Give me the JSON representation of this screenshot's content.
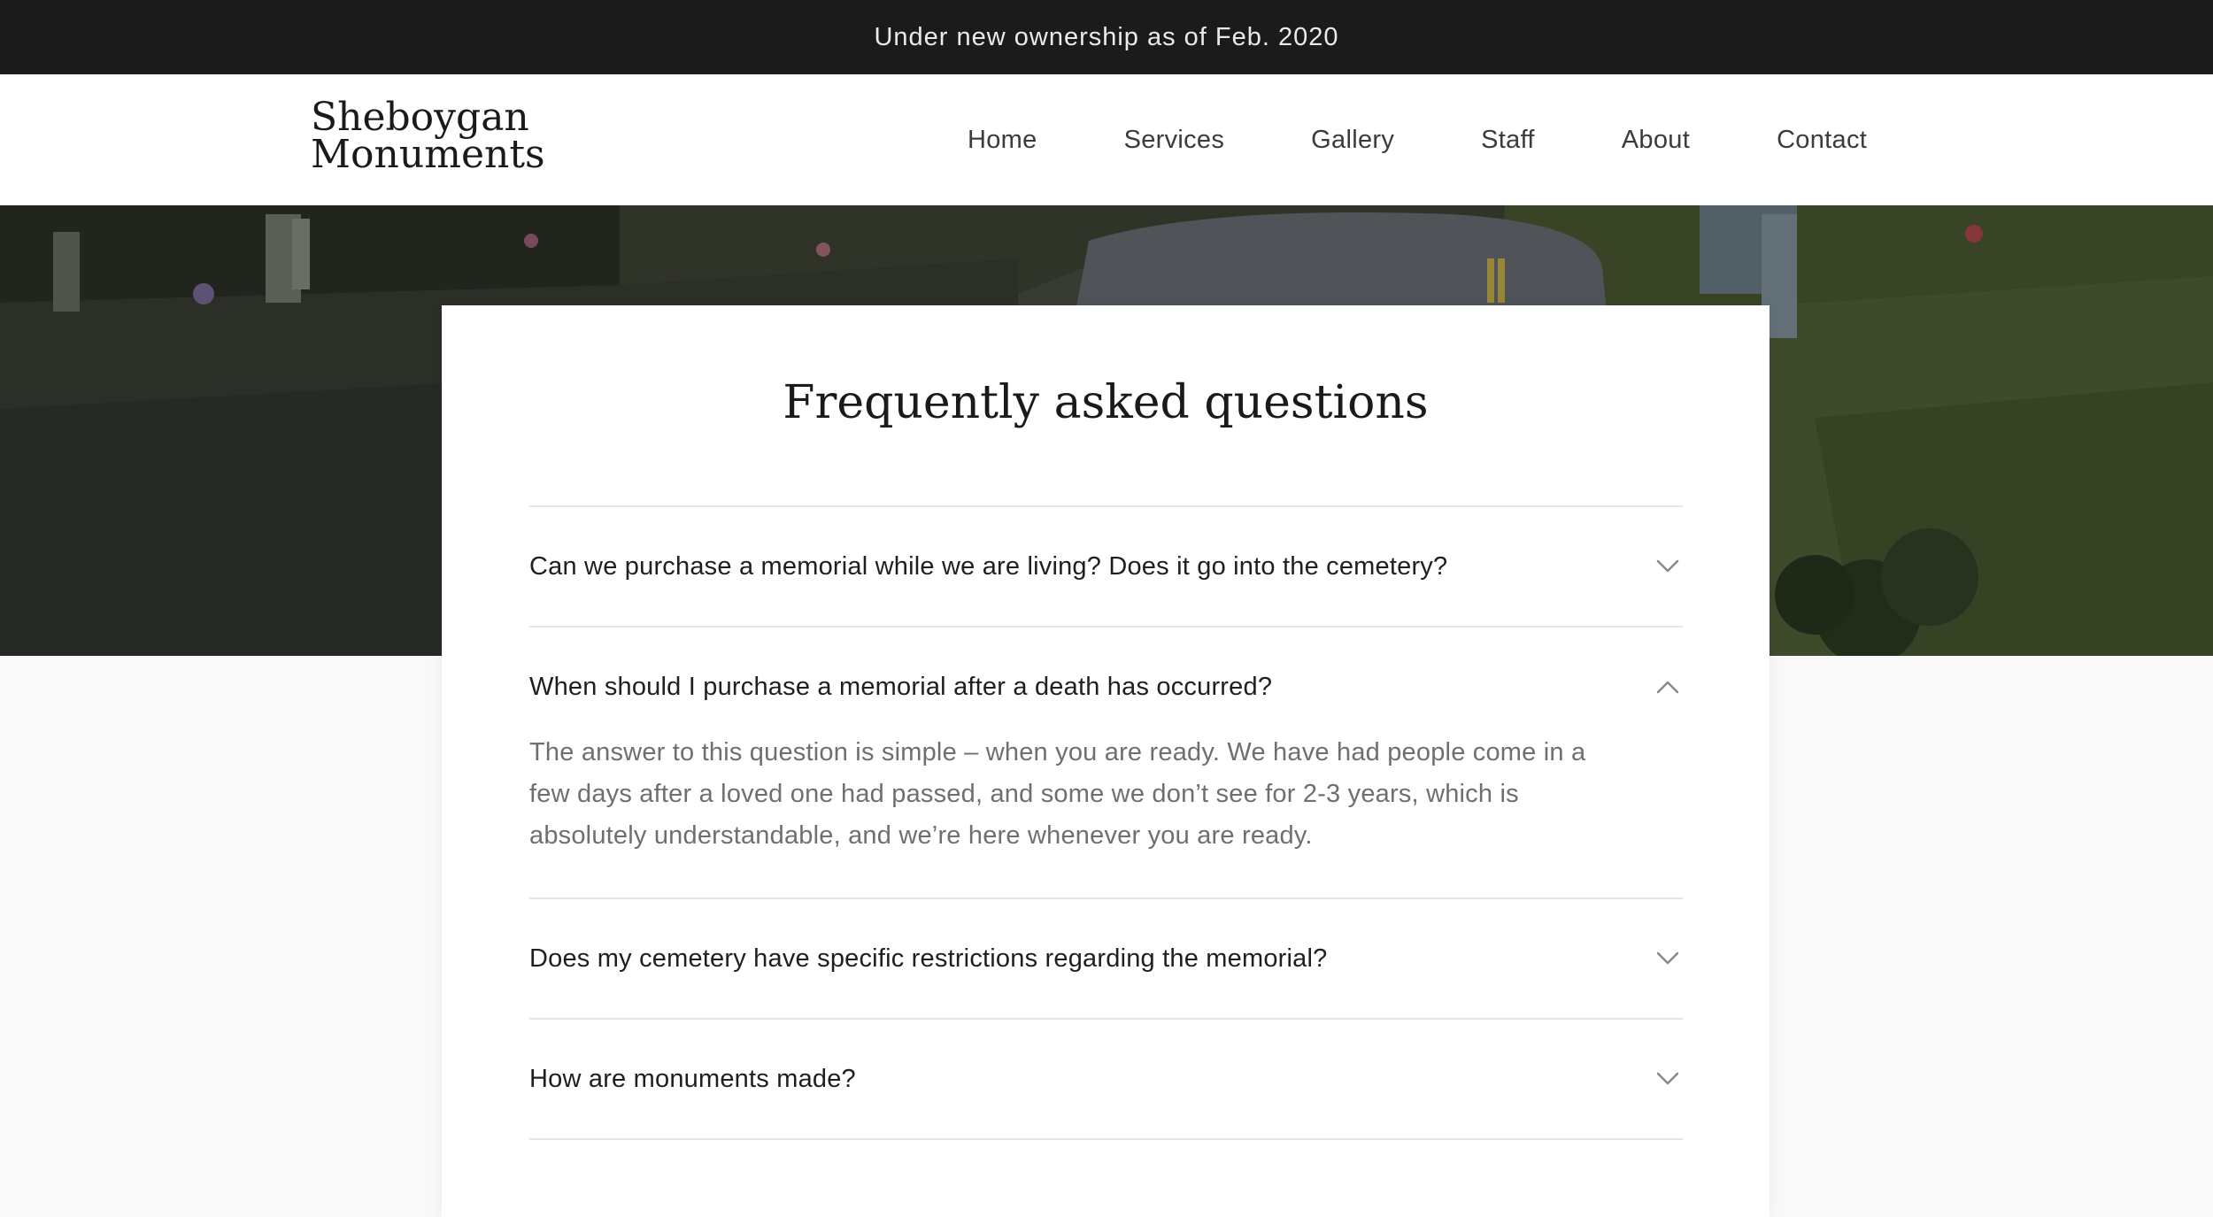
{
  "announcement": {
    "text": "Under new ownership as of Feb. 2020"
  },
  "header": {
    "logo_line1": "Sheboygan",
    "logo_line2": "Monuments",
    "nav": [
      {
        "label": "Home"
      },
      {
        "label": "Services"
      },
      {
        "label": "Gallery"
      },
      {
        "label": "Staff"
      },
      {
        "label": "About"
      },
      {
        "label": "Contact"
      }
    ]
  },
  "faq": {
    "title": "Frequently asked questions",
    "items": [
      {
        "question": "Can we purchase a memorial while we are living? Does it go into the cemetery?",
        "expanded": false,
        "icon": "chevron-down-icon"
      },
      {
        "question": "When should I purchase a memorial after a death has occurred?",
        "expanded": true,
        "icon": "chevron-up-icon",
        "answer": "The answer to this question is simple – when you are ready. We have had people come in a few days after a loved one had passed, and some we don’t see for 2-3 years, which is absolutely understandable, and we’re here whenever you are ready."
      },
      {
        "question": "Does my cemetery have specific restrictions regarding the memorial?",
        "expanded": false,
        "icon": "chevron-down-icon"
      },
      {
        "question": "How are monuments made?",
        "expanded": false,
        "icon": "chevron-down-icon"
      }
    ]
  },
  "colors": {
    "announcement_bg": "#1b1b1b",
    "header_bg": "#ffffff",
    "page_bg": "#f9f9f9",
    "divider": "#e5e5e5",
    "answer_text": "#6f6f6f"
  }
}
